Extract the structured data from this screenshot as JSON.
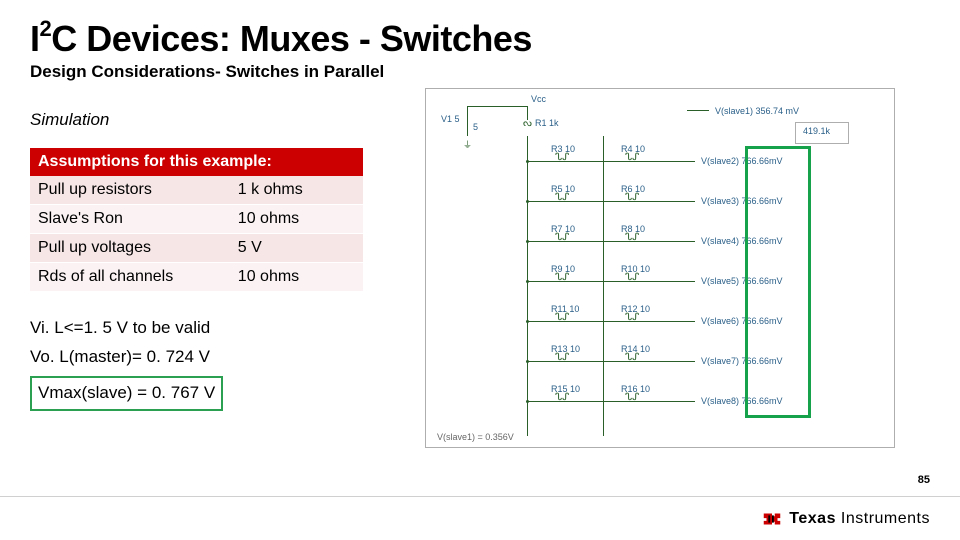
{
  "title_pre": "I",
  "title_sup": "2",
  "title_post": "C Devices: Muxes - Switches",
  "subtitle": "Design Considerations- Switches in Parallel",
  "sim_label": "Simulation",
  "table": {
    "header": "Assumptions for this example:",
    "rows": [
      {
        "param": "Pull up resistors",
        "val": "1 k ohms"
      },
      {
        "param": "Slave's Ron",
        "val": "10 ohms"
      },
      {
        "param": "Pull up voltages",
        "val": "5 V"
      },
      {
        "param": "Rds of all channels",
        "val": "10 ohms"
      }
    ]
  },
  "notes": {
    "line1": "Vi. L<=1. 5 V to be valid",
    "line2": "Vo. L(master)= 0. 724 V",
    "line3": "Vmax(slave) = 0. 767 V"
  },
  "schematic": {
    "top": {
      "vcc": "Vcc",
      "v1": "V1 5",
      "vmaster": "V(slave1) 356.74 mV",
      "r1": "R1 1k",
      "voltreg": "5",
      "gnd": "⏚"
    },
    "nodes": [
      {
        "r_a": "R3 10",
        "r_b": "R4 10",
        "v": "V(slave2) 766.66mV"
      },
      {
        "r_a": "R5 10",
        "r_b": "R6 10",
        "v": "V(slave3) 766.66mV"
      },
      {
        "r_a": "R7 10",
        "r_b": "R8 10",
        "v": "V(slave4) 766.66mV"
      },
      {
        "r_a": "R9 10",
        "r_b": "R10 10",
        "v": "V(slave5) 766.66mV"
      },
      {
        "r_a": "R11 10",
        "r_b": "R12 10",
        "v": "V(slave6) 766.66mV"
      },
      {
        "r_a": "R13 10",
        "r_b": "R14 10",
        "v": "V(slave7) 766.66mV"
      },
      {
        "r_a": "R15 10",
        "r_b": "R16 10",
        "v": "V(slave8) 766.66mV"
      }
    ],
    "right_box": "419.1k",
    "bottom_note": "V(slave1) = 0.356V"
  },
  "page_number": "85",
  "footer": {
    "brand_bold": "Texas ",
    "brand_rest": "Instruments"
  }
}
